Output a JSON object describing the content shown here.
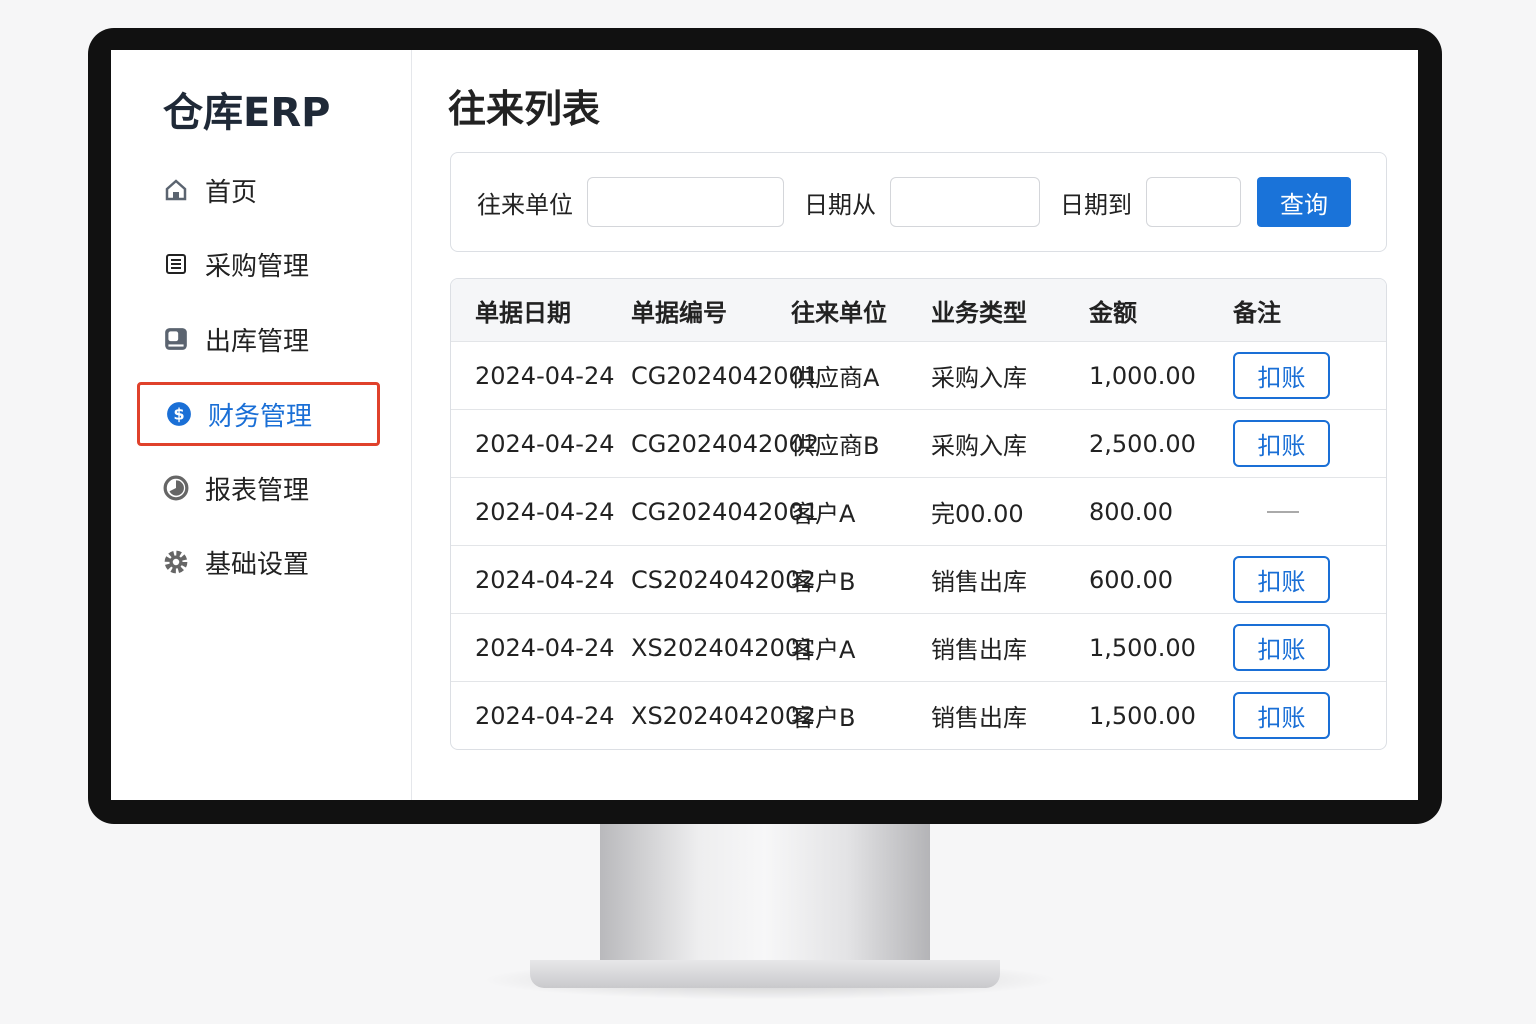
{
  "sidebar": {
    "logo": "仓库ERP",
    "items": [
      {
        "label": "首页",
        "icon": "home-icon"
      },
      {
        "label": "采购管理",
        "icon": "list-icon"
      },
      {
        "label": "出库管理",
        "icon": "box-icon"
      },
      {
        "label": "财务管理",
        "icon": "dollar-icon",
        "active": true
      },
      {
        "label": "报表管理",
        "icon": "chart-icon"
      },
      {
        "label": "基础设置",
        "icon": "gear-icon"
      }
    ]
  },
  "main": {
    "title": "往来列表",
    "filter": {
      "unit_label": "往来单位",
      "unit_value": "",
      "date_from_label": "日期从",
      "date_from_value": "",
      "date_to_label": "日期到",
      "date_to_value": "",
      "query_label": "查询"
    },
    "table": {
      "headers": [
        "单据日期",
        "单据编号",
        "往来单位",
        "业务类型",
        "金额",
        "备注"
      ],
      "rows": [
        [
          "2024-04-24",
          "CG2024042001",
          "供应商A",
          "采购入库",
          "1,000.00",
          "扣账"
        ],
        [
          "2024-04-24",
          "CG2024042002",
          "供应商B",
          "采购入库",
          "2,500.00",
          "扣账"
        ],
        [
          "2024-04-24",
          "CG2024042001",
          "客户A",
          "完00.00",
          "800.00",
          "—"
        ],
        [
          "2024-04-24",
          "CS2024042002",
          "客户B",
          "销售出库",
          "600.00",
          "扣账"
        ],
        [
          "2024-04-24",
          "XS2024042001",
          "客户A",
          "销售出库",
          "1,500.00",
          "扣账"
        ],
        [
          "2024-04-24",
          "XS2024042002",
          "客户B",
          "销售出库",
          "1,500.00",
          "扣账"
        ]
      ]
    }
  },
  "colors": {
    "accent": "#1a73d9",
    "highlight": "#e0412b"
  }
}
